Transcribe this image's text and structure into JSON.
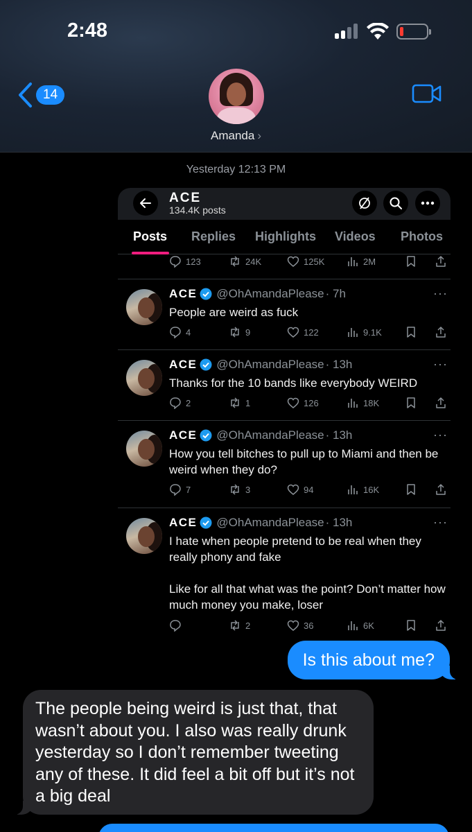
{
  "status_bar": {
    "time": "2:48"
  },
  "header": {
    "back_count": "14",
    "contact_name": "Amanda",
    "contact_chevron": "›"
  },
  "timestamp": {
    "day": "Yesterday",
    "time": "12:13 PM"
  },
  "screenshot": {
    "profile": {
      "name": "ACE",
      "posts": "134.4K posts"
    },
    "tabs": [
      "Posts",
      "Replies",
      "Highlights",
      "Videos",
      "Photos"
    ],
    "active_tab": "Posts",
    "top_actions": {
      "replies": "123",
      "reposts": "24K",
      "likes": "125K",
      "views": "2M"
    },
    "tweets": [
      {
        "name": "ACE",
        "handle": "@OhAmandaPlease",
        "time": "· 7h",
        "text": "People are weird as fuck",
        "replies": "4",
        "reposts": "9",
        "likes": "122",
        "views": "9.1K"
      },
      {
        "name": "ACE",
        "handle": "@OhAmandaPlease",
        "time": "· 13h",
        "text": "Thanks for the 10 bands like everybody WEIRD",
        "replies": "2",
        "reposts": "1",
        "likes": "126",
        "views": "18K"
      },
      {
        "name": "ACE",
        "handle": "@OhAmandaPlease",
        "time": "· 13h",
        "text": "How you tell bitches to pull up to Miami and then be weird when they do?",
        "replies": "7",
        "reposts": "3",
        "likes": "94",
        "views": "16K"
      },
      {
        "name": "ACE",
        "handle": "@OhAmandaPlease",
        "time": "· 13h",
        "text": "I hate when people pretend to be real when they really phony and fake\n\nLike for all that what was the point? Don’t matter how much money you make, loser",
        "replies": "",
        "reposts": "2",
        "likes": "36",
        "views": "6K"
      }
    ]
  },
  "messages": {
    "outgoing": "Is this about me?",
    "incoming": "The people being weird is just that, that wasn’t about you. I also was really drunk yesterday so I don’t remember tweeting any of these. It did feel a bit off but it’s not a big deal"
  },
  "colors": {
    "imessage_blue": "#1a8cff",
    "incoming_gray": "#262629",
    "x_accent": "#f01d7f",
    "verified_blue": "#1d9bf0"
  }
}
